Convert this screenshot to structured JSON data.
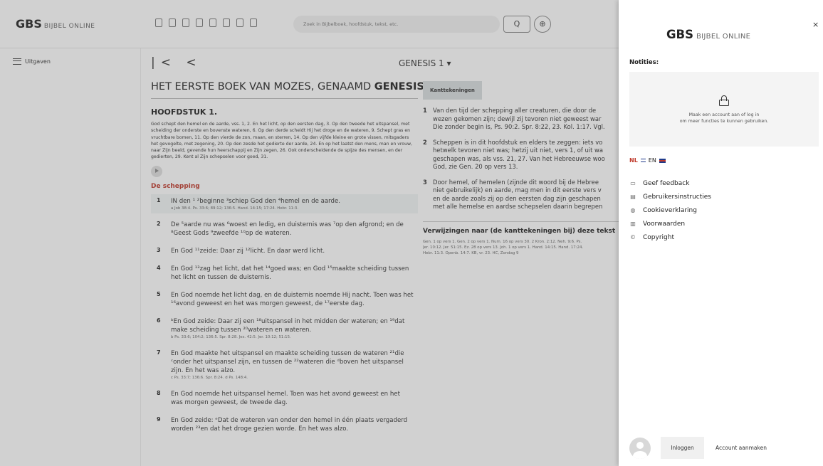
{
  "header": {
    "brand_main": "GBS",
    "brand_sub": "BIJBEL ONLINE",
    "search_placeholder": "Zoek in Bijbelboek, hoofdstuk, tekst, etc.",
    "search_icon": "Q",
    "zoom_icon": "⊕"
  },
  "nav": {
    "menu_label": "Uitgaven",
    "arrows": "|< <",
    "book_selector": "GENESIS 1 ▾"
  },
  "main": {
    "book_title_prefix": "HET EERSTE BOEK VAN MOZES, GENAAMD ",
    "book_title_bold": "GENESIS",
    "chapter": "HOOFDSTUK 1.",
    "summary": "God schept den hemel en de aarde, vss. 1, 2. En het licht, op den eersten dag, 3. Op den tweede het uitspansel, met scheiding der onderste en bovenste wateren, 6. Op den derde scheidt Hij het droge en de wateren, 9. Schept gras en vruchtbare bomen, 11. Op den vierde de zon, maan, en sterren, 14. Op den vijfde kleine en grote vissen, mitsgaders het gevogelte, met zegening, 20. Op den zesde het gedierte der aarde, 24. En op het laatst den mens, man en vrouw, naar Zijn beeld, gevende hun heerschappij en Zijn zegen, 26. Ook onderscheidende de spijze des mensen, en der gedierten, 29. Kent al Zijn schepselen voor goed, 31.",
    "section": "De schepping",
    "verses": [
      {
        "num": "1",
        "text": "IN den ¹ ²beginne ³schiep God den ⁴hemel en de aarde.",
        "ref": "a Job 38:4. Ps. 33:6; 89:12; 136:5. Hand. 14:15; 17:24. Hebr. 11:3."
      },
      {
        "num": "2",
        "text": "De ⁵aarde nu was ⁶woest en ledig, en duisternis was ⁷op den afgrond; en de ⁸Geest Gods ⁹zweefde ¹⁰op de wateren.",
        "ref": ""
      },
      {
        "num": "3",
        "text": "En God ¹¹zeide: Daar zij ¹²licht. En daar werd licht.",
        "ref": ""
      },
      {
        "num": "4",
        "text": "En God ¹³zag het licht, dat het ¹⁴goed was; en God ¹⁵maakte scheiding tussen het licht en tussen de duisternis.",
        "ref": ""
      },
      {
        "num": "5",
        "text": "En God noemde het licht dag, en de duisternis noemde Hij nacht. Toen was het ¹⁶avond geweest en het was morgen geweest, de ¹⁷eerste dag.",
        "ref": ""
      },
      {
        "num": "6",
        "text": "ᵇEn God zeide: Daar zij een ¹⁸uitspansel in het midden der wateren; en ¹⁹dat make scheiding tussen ²⁰wateren en wateren.",
        "ref": "b Ps. 33:6; 104:2; 136:5. Spr. 8:28. Jes. 42:5. Jer. 10:12; 51:15."
      },
      {
        "num": "7",
        "text": "En God maakte het uitspansel en maakte scheiding tussen de wateren ²¹die ᶜonder het uitspansel zijn, en tussen de ²²wateren die ᵈboven het uitspansel zijn. En het was alzo.",
        "ref": "c Ps. 33:7; 136:6. Spr. 8:24.  d Ps. 148:4."
      },
      {
        "num": "8",
        "text": "En God noemde het uitspansel hemel. Toen was het avond geweest en het was morgen geweest, de tweede dag.",
        "ref": ""
      },
      {
        "num": "9",
        "text": "En God zeide: ᵉDat de wateren van onder den hemel in één plaats vergaderd worden ²³en dat het droge gezien worde. En het was alzo.",
        "ref": ""
      }
    ]
  },
  "side": {
    "tab": "Kanttekeningen",
    "notes": [
      {
        "num": "1",
        "text": "Van den tijd der schepping aller creaturen, die door de\nwezen gekomen zijn; dewijl zij tevoren niet geweest war\nDie zonder begin is, Ps. 90:2. Spr. 8:22, 23. Kol. 1:17. Vgl."
      },
      {
        "num": "2",
        "text": "Scheppen is in dit hoofdstuk en elders te zeggen: iets vo\nhetwelk tevoren niet was; hetzij uit niet, vers 1, of uit wa\ngeschapen was, als vss. 21, 27. Van het Hebreeuwse woo\nGod, zie Gen. 20 op vers 13."
      },
      {
        "num": "3",
        "text": "Door hemel, of hemelen (zijnde dit woord bij de Hebree\nniet gebruikelijk) en aarde, mag men in dit eerste vers v\nen de aarde zoals zij op den eersten dag zijn geschapen\nmet alle hemelse en aardse schepselen daarin begrepen"
      }
    ],
    "refs_heading": "Verwijzingen naar (de kanttekeningen bij) deze tekst",
    "refs": "Gen. 1 op vers 1. Gen. 2 op vers 1. Num. 16 op vers 30. 2 Kron. 2:12. Neh. 9:6. Ps.\nJer. 10:12. Jer. 51:15. Ez. 28 op vers 13. Joh. 1 op vers 1. Hand. 14:15. Hand. 17:24.\nHebr. 11:3. Openb. 14:7. KB, vr. 23. HC, Zondag 9"
  },
  "panel": {
    "brand_main": "GBS",
    "brand_sub": "BIJBEL ONLINE",
    "close": "×",
    "notes_title": "Notities:",
    "notes_msg_1": "Maak een account aan of log in",
    "notes_msg_2": "om meer functies te kunnen gebruiken.",
    "lang_nl": "NL",
    "lang_en": "EN",
    "links": [
      {
        "icon": "comment-icon",
        "glyph": "▭",
        "label": "Geef feedback"
      },
      {
        "icon": "document-icon",
        "glyph": "▤",
        "label": "Gebruikersinstructies"
      },
      {
        "icon": "cookie-icon",
        "glyph": "◍",
        "label": "Cookieverklaring"
      },
      {
        "icon": "book-icon",
        "glyph": "▥",
        "label": "Voorwaarden"
      },
      {
        "icon": "copyright-icon",
        "glyph": "©",
        "label": "Copyright"
      }
    ],
    "login": "Inloggen",
    "create_account": "Account aanmaken"
  }
}
